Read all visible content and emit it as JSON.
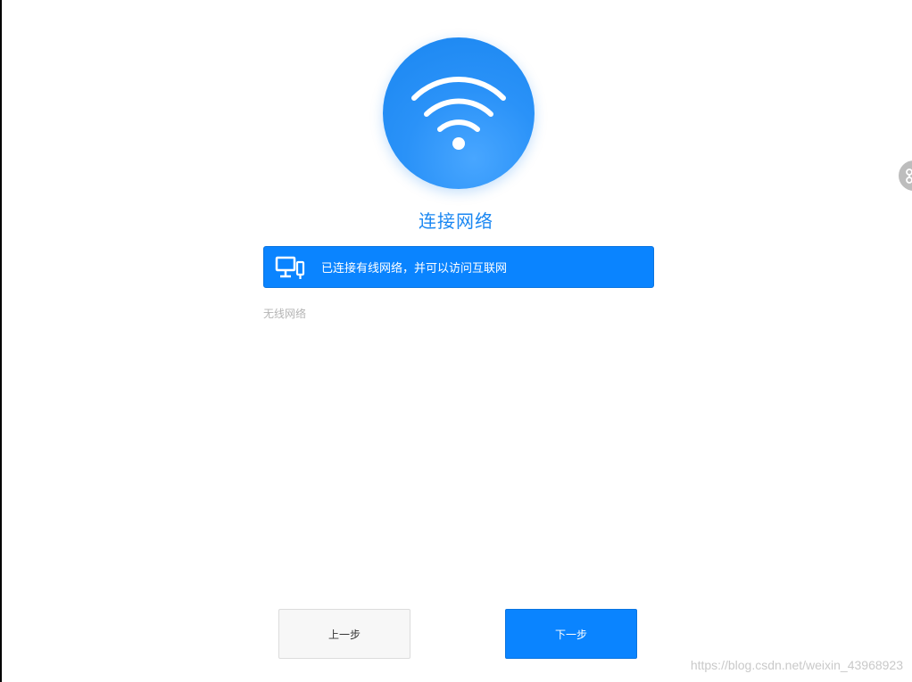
{
  "header": {
    "title": "连接网络"
  },
  "status": {
    "text": "已连接有线网络，并可以访问互联网",
    "icon": "wired-network-icon"
  },
  "wifi_section": {
    "label": "无线网络"
  },
  "buttons": {
    "prev_label": "上一步",
    "next_label": "下一步"
  },
  "watermark": {
    "text": "https://blog.csdn.net/weixin_43968923"
  },
  "colors": {
    "accent": "#0a84ff",
    "title": "#1a87f2",
    "muted": "#b4b4b4"
  },
  "icons": {
    "hero": "wifi-icon",
    "side": "share-icon"
  }
}
